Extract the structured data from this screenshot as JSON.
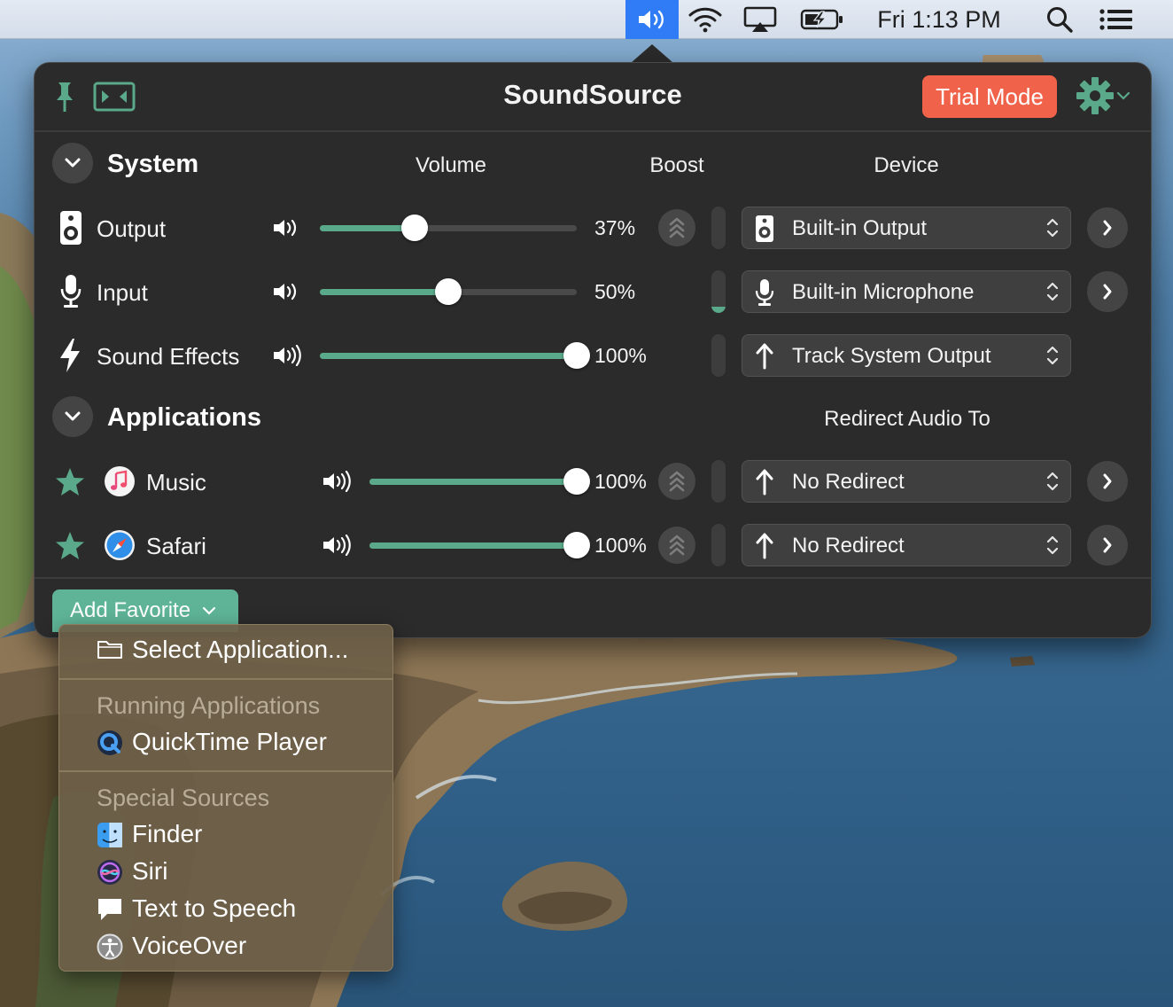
{
  "menubar": {
    "clock": "Fri 1:13 PM",
    "items": [
      "speaker-icon",
      "wifi-icon",
      "airplay-icon",
      "battery-icon",
      "search-icon",
      "control-center-icon"
    ]
  },
  "panel": {
    "title": "SoundSource",
    "trial_label": "Trial Mode",
    "system": {
      "title": "System",
      "col_volume": "Volume",
      "col_boost": "Boost",
      "col_device": "Device",
      "rows": [
        {
          "label": "Output",
          "volume": 0.37,
          "volume_label": "37%",
          "device": "Built-in Output",
          "level": 0.0
        },
        {
          "label": "Input",
          "volume": 0.5,
          "volume_label": "50%",
          "device": "Built-in Microphone",
          "level": 0.15
        },
        {
          "label": "Sound Effects",
          "volume": 1.0,
          "volume_label": "100%",
          "device": "Track System Output",
          "level": 0.0
        }
      ]
    },
    "applications": {
      "title": "Applications",
      "col_redirect": "Redirect Audio To",
      "rows": [
        {
          "label": "Music",
          "volume": 1.0,
          "volume_label": "100%",
          "redirect": "No Redirect"
        },
        {
          "label": "Safari",
          "volume": 1.0,
          "volume_label": "100%",
          "redirect": "No Redirect"
        }
      ]
    },
    "add_favorite": "Add Favorite"
  },
  "menu": {
    "select_app": "Select Application...",
    "running_header": "Running Applications",
    "running": [
      "QuickTime Player"
    ],
    "special_header": "Special Sources",
    "special": [
      "Finder",
      "Siri",
      "Text to Speech",
      "VoiceOver"
    ]
  },
  "colors": {
    "accent": "#5aa98a",
    "trial": "#f0634a",
    "menubar_highlight": "#2f7cf6"
  }
}
